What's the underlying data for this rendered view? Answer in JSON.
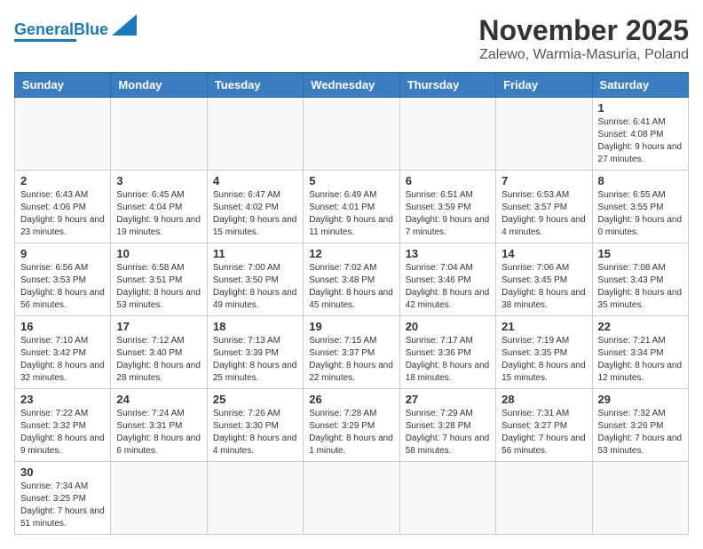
{
  "header": {
    "logo_general": "General",
    "logo_blue": "Blue",
    "month_title": "November 2025",
    "location": "Zalewo, Warmia-Masuria, Poland"
  },
  "weekdays": [
    "Sunday",
    "Monday",
    "Tuesday",
    "Wednesday",
    "Thursday",
    "Friday",
    "Saturday"
  ],
  "weeks": [
    [
      {
        "day": "",
        "info": ""
      },
      {
        "day": "",
        "info": ""
      },
      {
        "day": "",
        "info": ""
      },
      {
        "day": "",
        "info": ""
      },
      {
        "day": "",
        "info": ""
      },
      {
        "day": "",
        "info": ""
      },
      {
        "day": "1",
        "info": "Sunrise: 6:41 AM\nSunset: 4:08 PM\nDaylight: 9 hours and 27 minutes."
      }
    ],
    [
      {
        "day": "2",
        "info": "Sunrise: 6:43 AM\nSunset: 4:06 PM\nDaylight: 9 hours and 23 minutes."
      },
      {
        "day": "3",
        "info": "Sunrise: 6:45 AM\nSunset: 4:04 PM\nDaylight: 9 hours and 19 minutes."
      },
      {
        "day": "4",
        "info": "Sunrise: 6:47 AM\nSunset: 4:02 PM\nDaylight: 9 hours and 15 minutes."
      },
      {
        "day": "5",
        "info": "Sunrise: 6:49 AM\nSunset: 4:01 PM\nDaylight: 9 hours and 11 minutes."
      },
      {
        "day": "6",
        "info": "Sunrise: 6:51 AM\nSunset: 3:59 PM\nDaylight: 9 hours and 7 minutes."
      },
      {
        "day": "7",
        "info": "Sunrise: 6:53 AM\nSunset: 3:57 PM\nDaylight: 9 hours and 4 minutes."
      },
      {
        "day": "8",
        "info": "Sunrise: 6:55 AM\nSunset: 3:55 PM\nDaylight: 9 hours and 0 minutes."
      }
    ],
    [
      {
        "day": "9",
        "info": "Sunrise: 6:56 AM\nSunset: 3:53 PM\nDaylight: 8 hours and 56 minutes."
      },
      {
        "day": "10",
        "info": "Sunrise: 6:58 AM\nSunset: 3:51 PM\nDaylight: 8 hours and 53 minutes."
      },
      {
        "day": "11",
        "info": "Sunrise: 7:00 AM\nSunset: 3:50 PM\nDaylight: 8 hours and 49 minutes."
      },
      {
        "day": "12",
        "info": "Sunrise: 7:02 AM\nSunset: 3:48 PM\nDaylight: 8 hours and 45 minutes."
      },
      {
        "day": "13",
        "info": "Sunrise: 7:04 AM\nSunset: 3:46 PM\nDaylight: 8 hours and 42 minutes."
      },
      {
        "day": "14",
        "info": "Sunrise: 7:06 AM\nSunset: 3:45 PM\nDaylight: 8 hours and 38 minutes."
      },
      {
        "day": "15",
        "info": "Sunrise: 7:08 AM\nSunset: 3:43 PM\nDaylight: 8 hours and 35 minutes."
      }
    ],
    [
      {
        "day": "16",
        "info": "Sunrise: 7:10 AM\nSunset: 3:42 PM\nDaylight: 8 hours and 32 minutes."
      },
      {
        "day": "17",
        "info": "Sunrise: 7:12 AM\nSunset: 3:40 PM\nDaylight: 8 hours and 28 minutes."
      },
      {
        "day": "18",
        "info": "Sunrise: 7:13 AM\nSunset: 3:39 PM\nDaylight: 8 hours and 25 minutes."
      },
      {
        "day": "19",
        "info": "Sunrise: 7:15 AM\nSunset: 3:37 PM\nDaylight: 8 hours and 22 minutes."
      },
      {
        "day": "20",
        "info": "Sunrise: 7:17 AM\nSunset: 3:36 PM\nDaylight: 8 hours and 18 minutes."
      },
      {
        "day": "21",
        "info": "Sunrise: 7:19 AM\nSunset: 3:35 PM\nDaylight: 8 hours and 15 minutes."
      },
      {
        "day": "22",
        "info": "Sunrise: 7:21 AM\nSunset: 3:34 PM\nDaylight: 8 hours and 12 minutes."
      }
    ],
    [
      {
        "day": "23",
        "info": "Sunrise: 7:22 AM\nSunset: 3:32 PM\nDaylight: 8 hours and 9 minutes."
      },
      {
        "day": "24",
        "info": "Sunrise: 7:24 AM\nSunset: 3:31 PM\nDaylight: 8 hours and 6 minutes."
      },
      {
        "day": "25",
        "info": "Sunrise: 7:26 AM\nSunset: 3:30 PM\nDaylight: 8 hours and 4 minutes."
      },
      {
        "day": "26",
        "info": "Sunrise: 7:28 AM\nSunset: 3:29 PM\nDaylight: 8 hours and 1 minute."
      },
      {
        "day": "27",
        "info": "Sunrise: 7:29 AM\nSunset: 3:28 PM\nDaylight: 7 hours and 58 minutes."
      },
      {
        "day": "28",
        "info": "Sunrise: 7:31 AM\nSunset: 3:27 PM\nDaylight: 7 hours and 56 minutes."
      },
      {
        "day": "29",
        "info": "Sunrise: 7:32 AM\nSunset: 3:26 PM\nDaylight: 7 hours and 53 minutes."
      }
    ],
    [
      {
        "day": "30",
        "info": "Sunrise: 7:34 AM\nSunset: 3:25 PM\nDaylight: 7 hours and 51 minutes."
      },
      {
        "day": "",
        "info": ""
      },
      {
        "day": "",
        "info": ""
      },
      {
        "day": "",
        "info": ""
      },
      {
        "day": "",
        "info": ""
      },
      {
        "day": "",
        "info": ""
      },
      {
        "day": "",
        "info": ""
      }
    ]
  ]
}
